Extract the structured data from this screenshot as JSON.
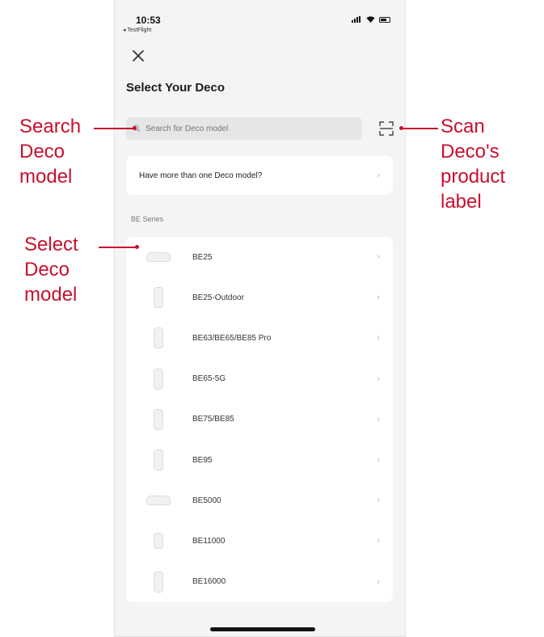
{
  "status_bar": {
    "time": "10:53",
    "back_app": "◂ TestFlight"
  },
  "header": {
    "title": "Select Your Deco"
  },
  "search": {
    "placeholder": "Search for Deco model"
  },
  "multi_model": {
    "label": "Have more than one Deco model?"
  },
  "series": {
    "label": "BE Series",
    "items": [
      {
        "name": "BE25",
        "device": "flat"
      },
      {
        "name": "BE25-Outdoor",
        "device": "tower"
      },
      {
        "name": "BE63/BE65/BE85 Pro",
        "device": "tower"
      },
      {
        "name": "BE65-5G",
        "device": "tower"
      },
      {
        "name": "BE75/BE85",
        "device": "tower"
      },
      {
        "name": "BE95",
        "device": "tower"
      },
      {
        "name": "BE5000",
        "device": "flat"
      },
      {
        "name": "BE11000",
        "device": "tower"
      },
      {
        "name": "BE16000",
        "device": "tower"
      }
    ]
  },
  "annotations": {
    "search": [
      "Search",
      "Deco",
      "model"
    ],
    "scan": [
      "Scan",
      "Deco's",
      "product",
      "label"
    ],
    "select": [
      "Select",
      "Deco",
      "model"
    ]
  },
  "colors": {
    "annotation": "#c8102e",
    "background": "#f4f4f5"
  }
}
